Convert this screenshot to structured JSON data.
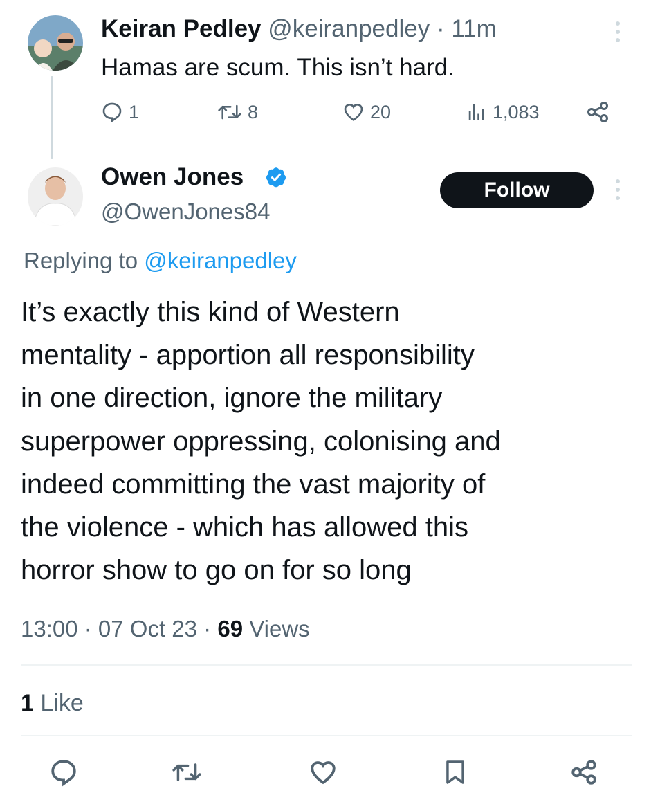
{
  "parent_tweet": {
    "name": "Keiran Pedley",
    "handle": "@keiranpedley",
    "separator": " · ",
    "time": "11m",
    "text": "Hamas are scum. This isn’t hard.",
    "replies": "1",
    "retweets": "8",
    "likes": "20",
    "views": "1,083"
  },
  "main_tweet": {
    "name": "Owen Jones",
    "handle": "@OwenJones84",
    "follow_label": "Follow",
    "replying_prefix": "Replying to ",
    "replying_to": "@keiranpedley",
    "text_lines": [
      "It’s exactly this kind of Western",
      "mentality - apportion all responsibility",
      "in one direction, ignore the military",
      "superpower oppressing, colonising and",
      "indeed committing the vast majority of",
      "the violence - which has allowed this",
      "horror show to go on for so long"
    ],
    "time": "13:00",
    "sep1": " · ",
    "date": "07 Oct 23",
    "sep2": " · ",
    "views_count": "69",
    "views_label": " Views",
    "likes_count": "1",
    "likes_label": " Like"
  },
  "colors": {
    "text": "#0f1419",
    "secondary": "#536471",
    "link": "#1d9bf0",
    "verified": "#1d9bf0",
    "follow_bg": "#0f1419",
    "divider": "#eff3f4"
  },
  "icons": {
    "reply": "speech-bubble-icon",
    "retweet": "retweet-arrows-icon",
    "like": "heart-icon",
    "views": "bar-chart-icon",
    "share": "share-nodes-icon",
    "bookmark": "bookmark-icon",
    "more": "vertical-dots-icon",
    "verified": "verified-badge-icon"
  }
}
